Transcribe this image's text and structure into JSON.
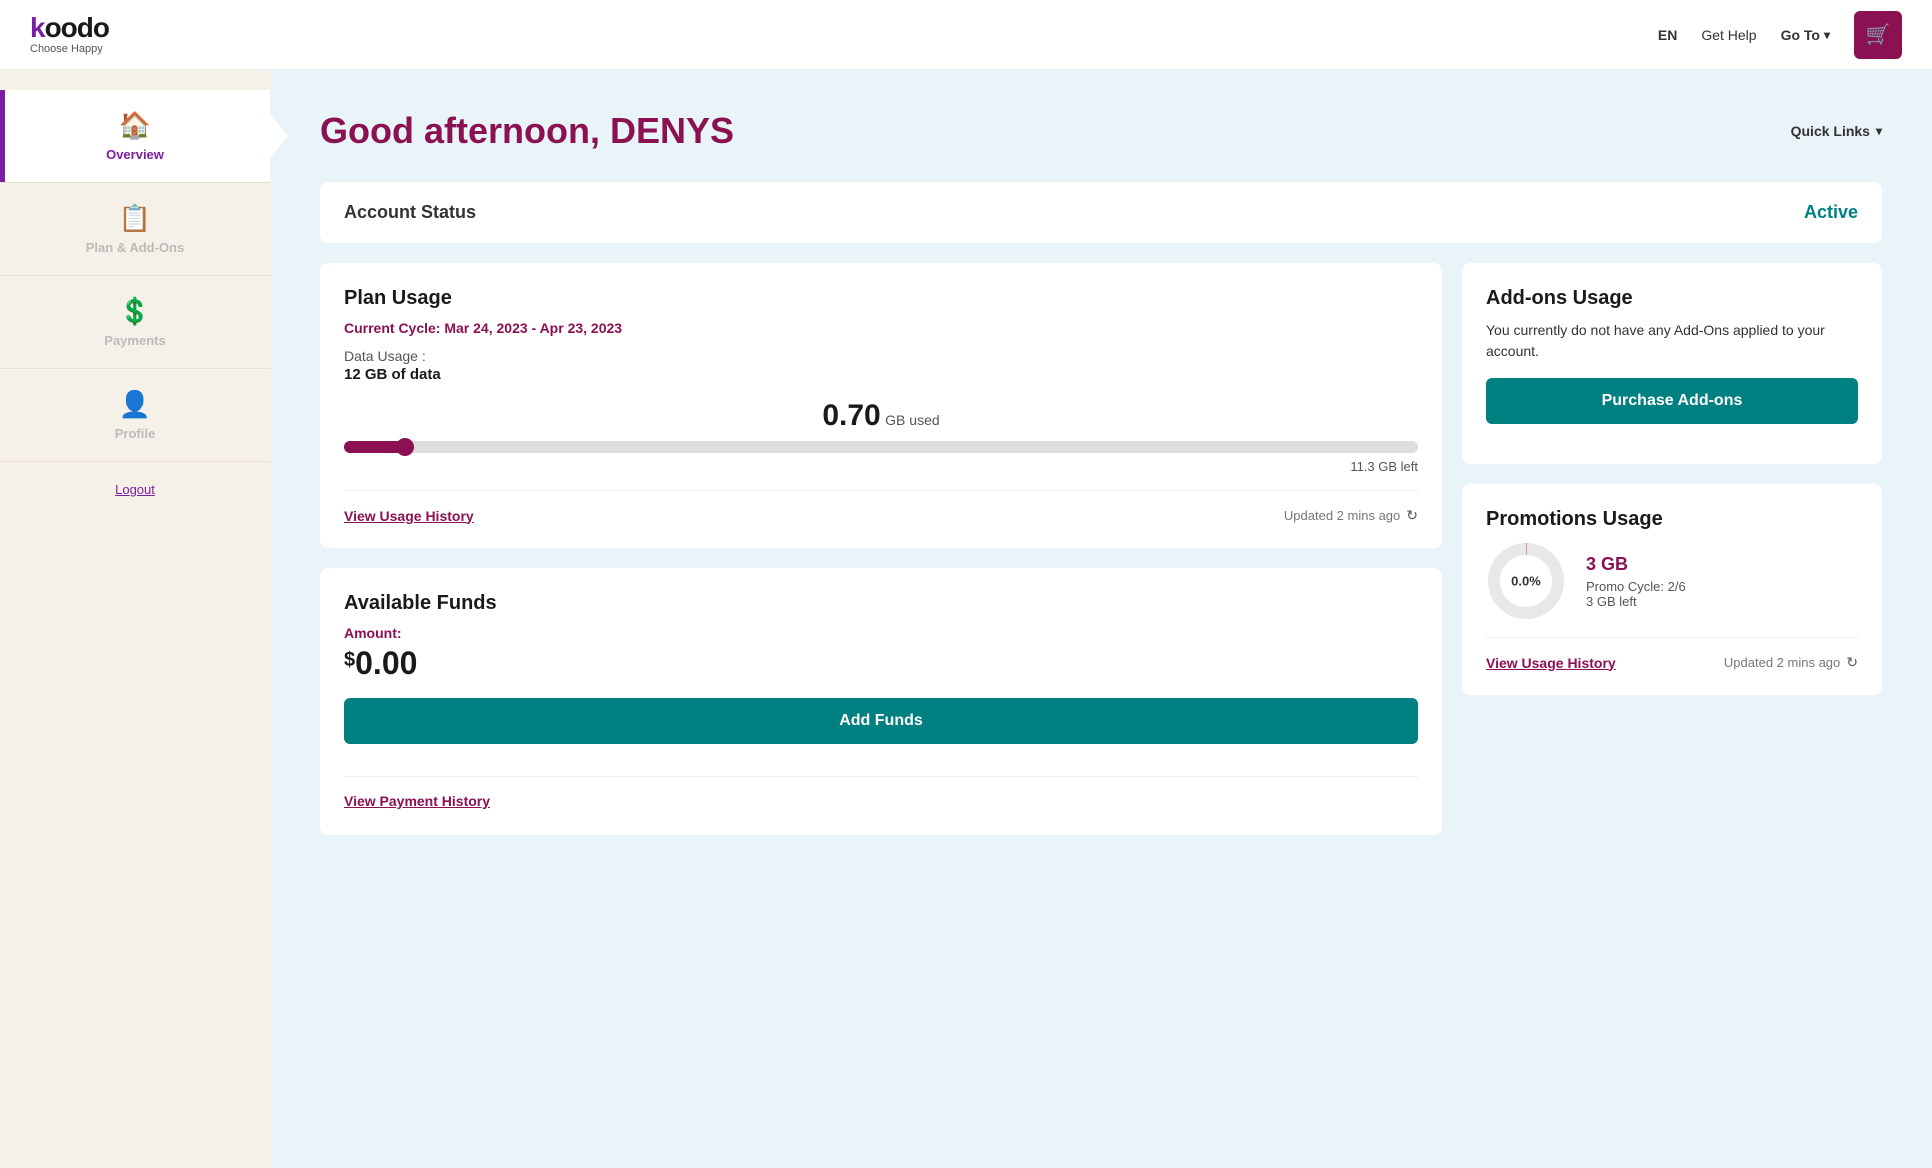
{
  "header": {
    "logo_main": "koodo",
    "logo_tagline": "Choose Happy",
    "lang_label": "EN",
    "help_label": "Get Help",
    "goto_label": "Go To",
    "cart_icon": "🛒"
  },
  "sidebar": {
    "items": [
      {
        "id": "overview",
        "label": "Overview",
        "icon": "🏠",
        "active": true
      },
      {
        "id": "plan-addons",
        "label": "Plan & Add-Ons",
        "icon": "📋",
        "active": false
      },
      {
        "id": "payments",
        "label": "Payments",
        "icon": "💲",
        "active": false
      },
      {
        "id": "profile",
        "label": "Profile",
        "icon": "👤",
        "active": false
      }
    ],
    "logout_label": "Logout"
  },
  "main": {
    "greeting": "Good afternoon, DENYS",
    "quick_links_label": "Quick Links",
    "account_status": {
      "label": "Account Status",
      "value": "Active"
    },
    "plan_usage": {
      "title": "Plan Usage",
      "cycle_label": "Current Cycle: Mar 24, 2023 - Apr 23, 2023",
      "data_usage_label": "Data Usage :",
      "data_amount": "12 GB of data",
      "usage_value": "0.70",
      "usage_unit": "GB used",
      "progress_percent": 5.8,
      "gb_left": "11.3 GB left",
      "view_history_label": "View Usage History",
      "updated_text": "Updated 2 mins ago"
    },
    "available_funds": {
      "title": "Available Funds",
      "amount_label": "Amount:",
      "currency": "$",
      "amount_int": "0",
      "amount_dec": ".00",
      "add_funds_label": "Add Funds",
      "view_payment_label": "View Payment History"
    },
    "addons_usage": {
      "title": "Add-ons Usage",
      "description": "You currently do not have any Add-Ons applied to your account.",
      "purchase_btn_label": "Purchase Add-ons"
    },
    "promotions_usage": {
      "title": "Promotions Usage",
      "donut_label": "0.0%",
      "promo_gb": "3 GB",
      "promo_cycle": "Promo Cycle: 2/6",
      "promo_left": "3 GB left",
      "view_history_label": "View Usage History",
      "updated_text": "Updated 2 mins ago"
    }
  }
}
